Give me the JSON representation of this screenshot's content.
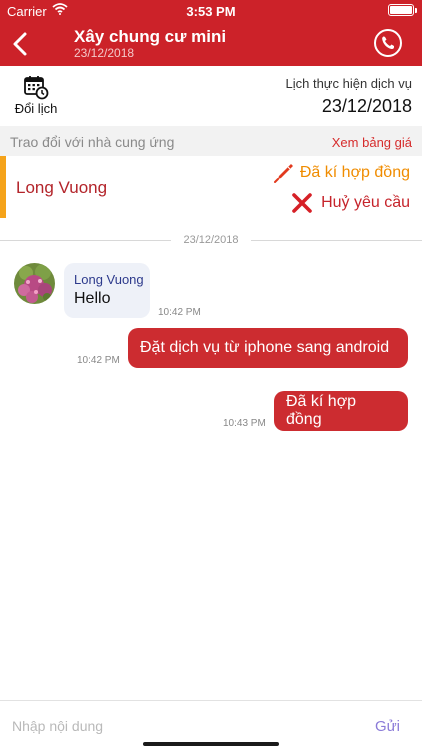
{
  "status_bar": {
    "carrier": "Carrier",
    "time": "3:53 PM"
  },
  "header": {
    "title": "Xây chung cư mini",
    "subtitle": "23/12/2018",
    "back_icon": "chevron-left-icon",
    "call_icon": "phone-icon",
    "background_color": "#cc2229"
  },
  "schedule": {
    "change_date_label": "Đổi lịch",
    "calendar_icon": "calendar-clock-icon",
    "label": "Lịch thực hiện dịch vụ",
    "date": "23/12/2018"
  },
  "section": {
    "title": "Trao đổi với nhà cung ứng",
    "price_link": "Xem bảng giá"
  },
  "provider": {
    "name": "Long Vuong",
    "accent_color": "#f5a31a",
    "actions": [
      {
        "label": "Đã kí hợp đồng",
        "icon": "pen-icon",
        "color": "#f08c00"
      },
      {
        "label": "Huỷ yêu cầu",
        "icon": "close-icon",
        "color": "#c6242b"
      }
    ]
  },
  "conversation": {
    "date_separator": "23/12/2018",
    "messages": [
      {
        "direction": "incoming",
        "sender": "Long Vuong",
        "text": "Hello",
        "time": "10:42 PM"
      },
      {
        "direction": "outgoing",
        "text": "Đặt dịch vụ từ iphone sang android",
        "time": "10:42 PM"
      },
      {
        "direction": "outgoing",
        "text": "Đã kí hợp đồng",
        "time": "10:43 PM"
      }
    ]
  },
  "composer": {
    "placeholder": "Nhập nội dung",
    "send_label": "Gửi"
  }
}
